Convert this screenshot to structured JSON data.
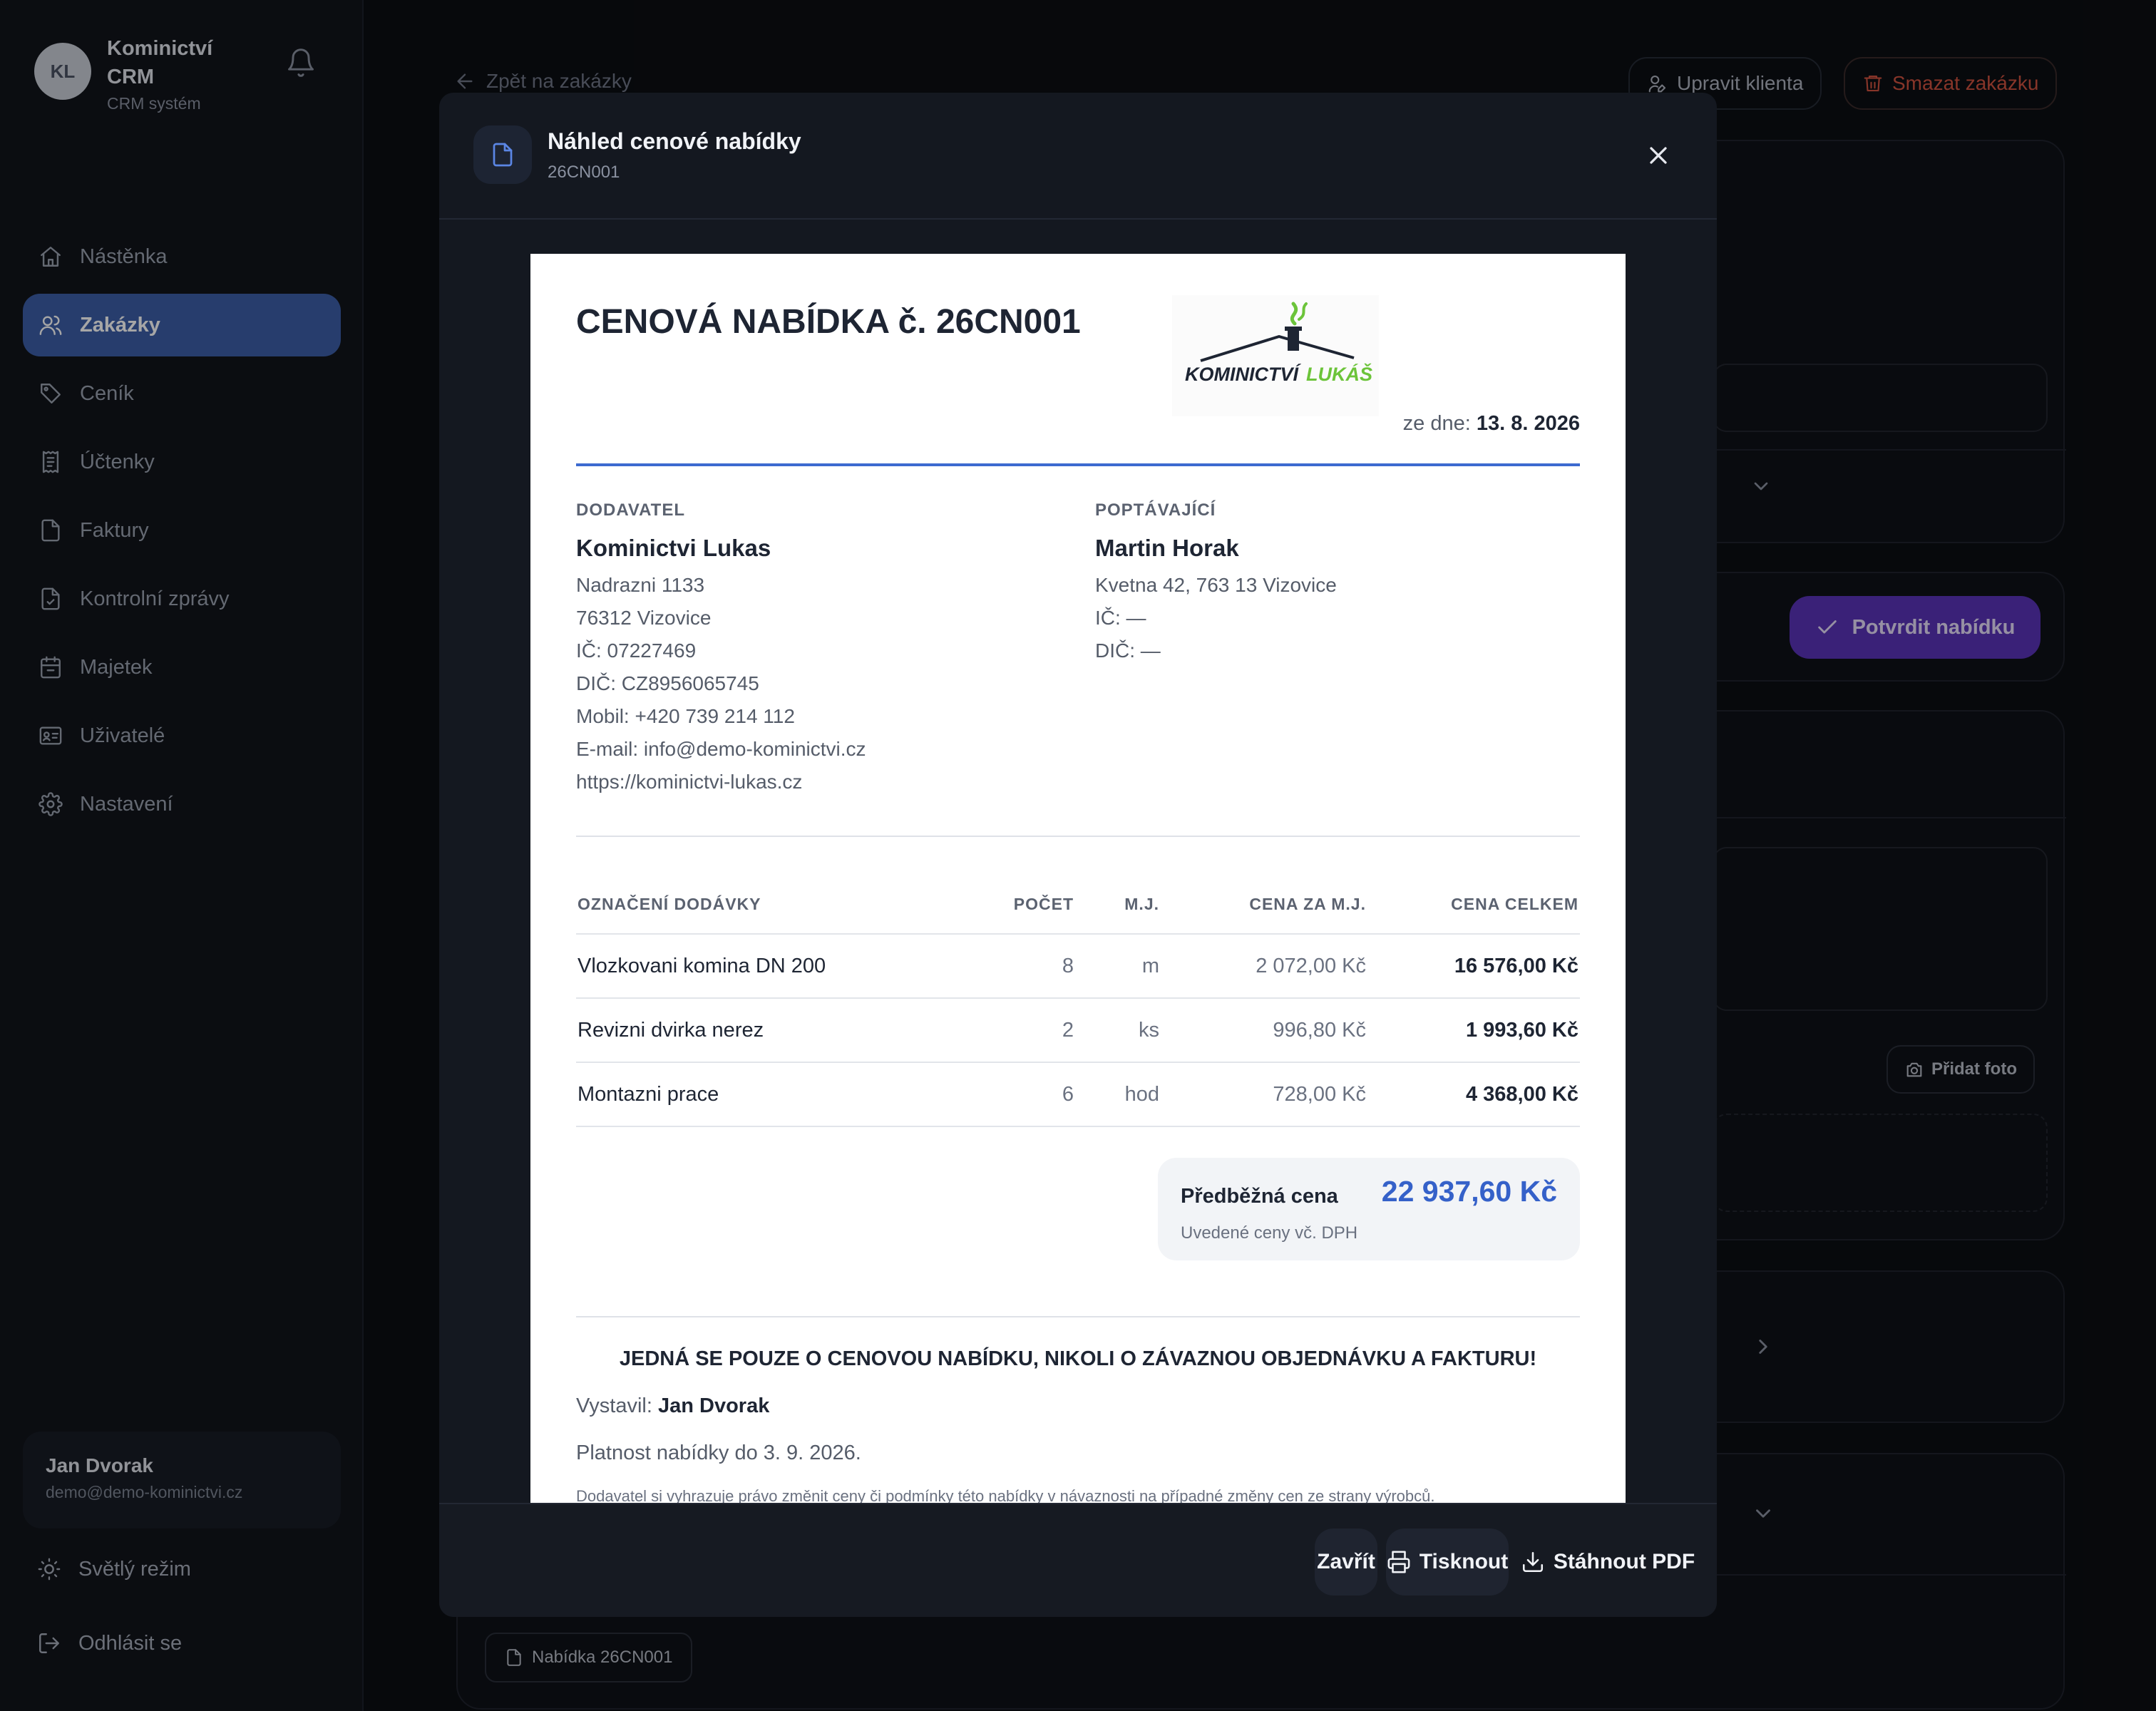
{
  "sidebar": {
    "brand": {
      "logo": "KL",
      "name": "Kominictví CRM",
      "sub": "CRM systém"
    },
    "items": [
      {
        "label": "Nástěnka",
        "icon": "home-icon"
      },
      {
        "label": "Zakázky",
        "icon": "users-icon",
        "active": true
      },
      {
        "label": "Ceník",
        "icon": "tag-icon"
      },
      {
        "label": "Účtenky",
        "icon": "receipt-icon"
      },
      {
        "label": "Faktury",
        "icon": "file-icon"
      },
      {
        "label": "Kontrolní zprávy",
        "icon": "file-check-icon"
      },
      {
        "label": "Majetek",
        "icon": "calendar-icon"
      },
      {
        "label": "Uživatelé",
        "icon": "id-card-icon"
      },
      {
        "label": "Nastavení",
        "icon": "gear-icon"
      }
    ],
    "user": {
      "name": "Jan Dvorak",
      "email": "demo@demo-kominictvi.cz"
    },
    "light_mode": "Světlý režim",
    "logout": "Odhlásit se"
  },
  "main": {
    "back": "Zpět na zakázky",
    "edit_client": "Upravit klienta",
    "delete_order": "Smazat zakázku",
    "confirm_offer": "Potvrdit nabídku",
    "add_photo": "Přidat foto",
    "offer_chip": "Nabídka 26CN001"
  },
  "modal": {
    "title": "Náhled cenové nabídky",
    "subtitle": "26CN001",
    "footer": {
      "close": "Zavřít",
      "print": "Tisknout",
      "download": "Stáhnout PDF"
    }
  },
  "document": {
    "title": "CENOVÁ NABÍDKA č. 26CN001",
    "logo_text": "KOMINICTVÍ LUKÁŠ",
    "date_label": "ze dne:",
    "date": "13. 8. 2026",
    "supplier": {
      "label": "DODAVATEL",
      "name": "Kominictvi Lukas",
      "lines": [
        "Nadrazni 1133",
        "76312 Vizovice",
        "IČ: 07227469",
        "DIČ: CZ8956065745",
        "Mobil: +420 739 214 112",
        "E-mail: info@demo-kominictvi.cz",
        "https://kominictvi-lukas.cz"
      ]
    },
    "customer": {
      "label": "POPTÁVAJÍCÍ",
      "name": "Martin Horak",
      "lines": [
        "Kvetna 42, 763 13 Vizovice",
        "IČ: —",
        "DIČ: —"
      ]
    },
    "table": {
      "headers": [
        "OZNAČENÍ DODÁVKY",
        "POČET",
        "M.J.",
        "CENA ZA M.J.",
        "CENA CELKEM"
      ],
      "rows": [
        [
          "Vlozkovani komina DN 200",
          "8",
          "m",
          "2 072,00 Kč",
          "16 576,00 Kč"
        ],
        [
          "Revizni dvirka nerez",
          "2",
          "ks",
          "996,80 Kč",
          "1 993,60 Kč"
        ],
        [
          "Montazni prace",
          "6",
          "hod",
          "728,00 Kč",
          "4 368,00 Kč"
        ]
      ]
    },
    "summary": {
      "label": "Předběžná cena",
      "value": "22 937,60 Kč",
      "note": "Uvedené ceny vč. DPH"
    },
    "warning": "JEDNÁ SE POUZE O CENOVOU NABÍDKU, NIKOLI O ZÁVAZNOU OBJEDNÁVKU A FAKTURU!",
    "issued_label": "Vystavil:",
    "issued_by": "Jan Dvorak",
    "validity": "Platnost nabídky do 3. 9. 2026.",
    "disclaimer": "Dodavatel si vyhrazuje právo změnit ceny či podmínky této nabídky v návaznosti na případné změny cen ze strany výrobců."
  },
  "colors": {
    "accent": "#3c5fa8",
    "confirm": "#5a34b8",
    "danger": "#d0523f",
    "price": "#3561c9",
    "rule": "#3d6ad0"
  }
}
